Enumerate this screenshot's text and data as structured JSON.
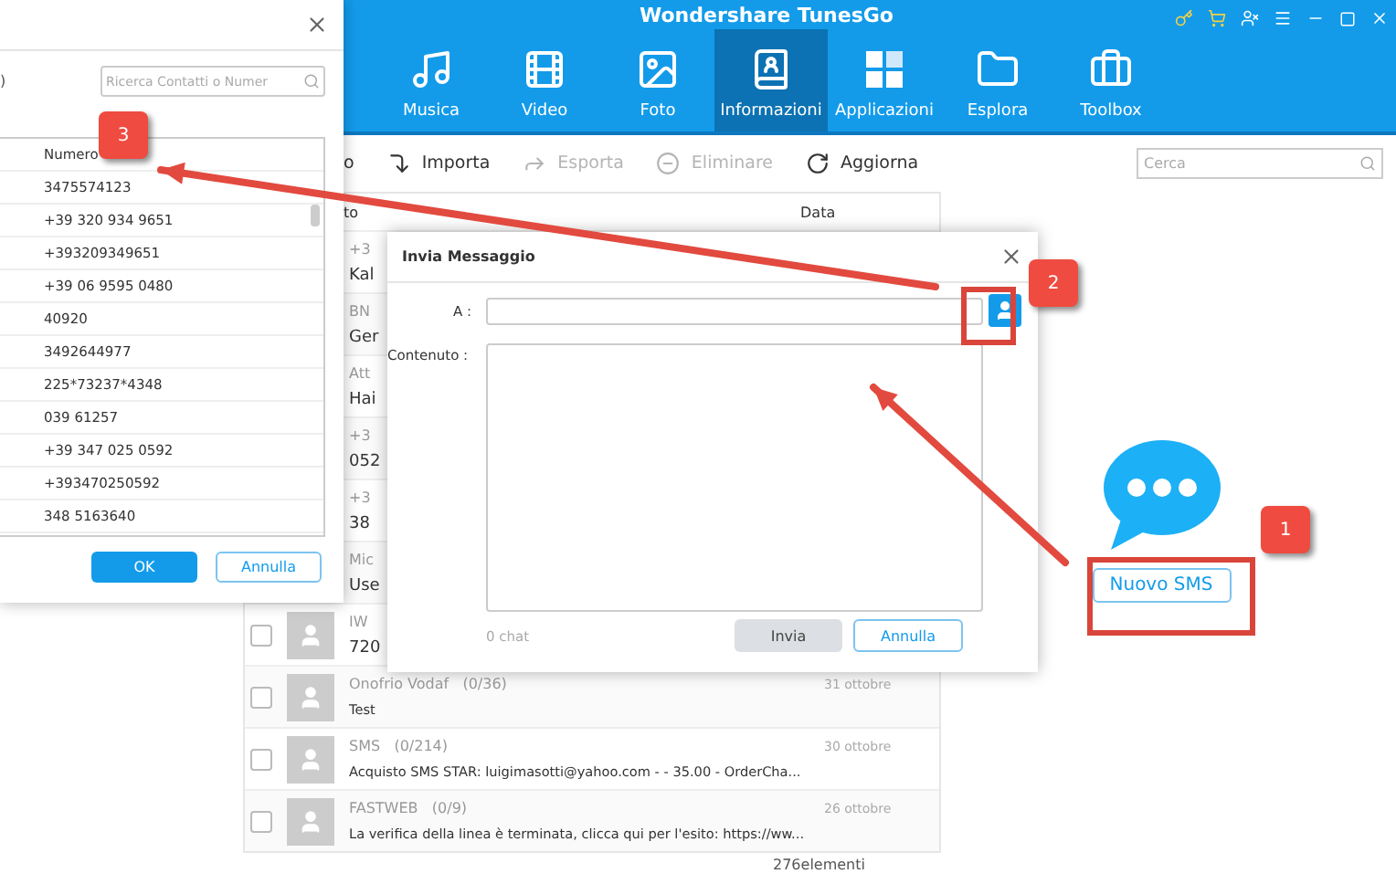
{
  "window": {
    "title": "Wondershare TunesGo"
  },
  "nav_tabs": [
    {
      "label": "Musica",
      "selected": false
    },
    {
      "label": "Video",
      "selected": false
    },
    {
      "label": "Foto",
      "selected": false
    },
    {
      "label": "Informazioni",
      "selected": true
    },
    {
      "label": "Applicazioni",
      "selected": false
    },
    {
      "label": "Esplora",
      "selected": false
    },
    {
      "label": "Toolbox",
      "selected": false
    }
  ],
  "toolbar": {
    "items": [
      {
        "label": "o",
        "disabled": false
      },
      {
        "label": "Importa",
        "disabled": false
      },
      {
        "label": "Esporta",
        "disabled": true
      },
      {
        "label": "Eliminare",
        "disabled": true
      },
      {
        "label": "Aggiorna",
        "disabled": false
      }
    ],
    "search": {
      "placeholder": "Cerca"
    }
  },
  "message_list": {
    "columns": [
      "to",
      "Data"
    ],
    "rows": [
      {
        "sender": "+3",
        "preview": "Kal"
      },
      {
        "sender": "BN",
        "preview": "Ger"
      },
      {
        "sender": "Att",
        "preview": "Hai"
      },
      {
        "sender": "+3",
        "preview": "052"
      },
      {
        "sender": "+3",
        "preview": "38"
      },
      {
        "sender": "Mic",
        "preview": "Use"
      },
      {
        "sender": "IW",
        "preview": "720",
        "checked": false
      },
      {
        "sender": "Onofrio Vodaf",
        "count": "(0/36)",
        "preview": "Test",
        "date": "31 ottobre",
        "checked": false
      },
      {
        "sender": "SMS",
        "count": "(0/214)",
        "preview": "Acquisto SMS STAR: luigimasotti@yahoo.com -  - 35.00 - OrderCha...",
        "date": "30 ottobre",
        "checked": false
      },
      {
        "sender": "FASTWEB",
        "count": "(0/9)",
        "preview": "La verifica della linea è terminata, clicca qui per l'esito: https://ww...",
        "date": "26 ottobre",
        "checked": false
      }
    ]
  },
  "status_bar": {
    "text": "276elementi"
  },
  "sms_panel": {
    "button": "Nuovo SMS"
  },
  "contacts_dialog": {
    "filter_label": ")",
    "search": {
      "placeholder": "Ricerca Contatti o Numer"
    },
    "columns": [
      "Numero"
    ],
    "numbers": [
      "3475574123",
      "+39 320 934 9651",
      "+393209349651",
      "+39 06 9595 0480",
      "40920",
      "3492644977",
      "225*73237*4348",
      "039 61257",
      "+39 347 025 0592",
      "+393470250592",
      "348 5163640"
    ],
    "buttons": [
      {
        "label": "OK",
        "kind": "primary"
      },
      {
        "label": "Annulla",
        "kind": "secondary"
      }
    ]
  },
  "message_dialog": {
    "title": "Invia Messaggio",
    "to_label": "A :",
    "content_label": "Contenuto :",
    "counter": "0 chat",
    "buttons": [
      {
        "label": "Invia",
        "kind": "grey"
      },
      {
        "label": "Annulla",
        "kind": "secondary"
      }
    ]
  },
  "annotations": [
    {
      "label": "1"
    },
    {
      "label": "2"
    },
    {
      "label": "3"
    }
  ]
}
